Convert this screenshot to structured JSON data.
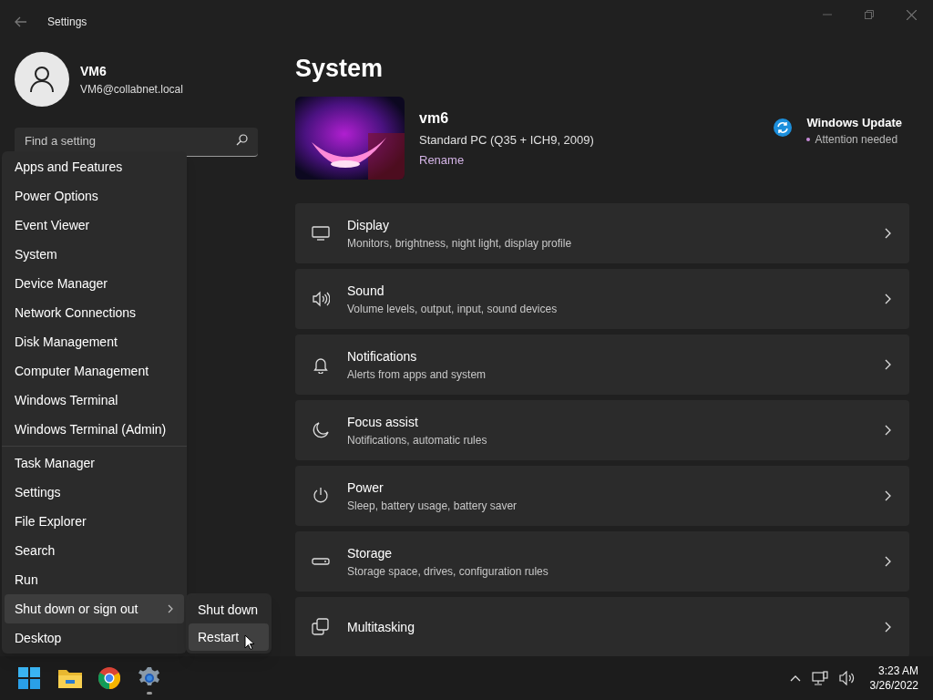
{
  "window": {
    "title": "Settings"
  },
  "account": {
    "name": "VM6",
    "email": "VM6@collabnet.local"
  },
  "search": {
    "placeholder": "Find a setting"
  },
  "page_title": "System",
  "device": {
    "name": "vm6",
    "model": "Standard PC (Q35 + ICH9, 2009)",
    "rename": "Rename"
  },
  "update": {
    "title": "Windows Update",
    "status": "Attention needed"
  },
  "cards": [
    {
      "title": "Display",
      "subtitle": "Monitors, brightness, night light, display profile"
    },
    {
      "title": "Sound",
      "subtitle": "Volume levels, output, input, sound devices"
    },
    {
      "title": "Notifications",
      "subtitle": "Alerts from apps and system"
    },
    {
      "title": "Focus assist",
      "subtitle": "Notifications, automatic rules"
    },
    {
      "title": "Power",
      "subtitle": "Sleep, battery usage, battery saver"
    },
    {
      "title": "Storage",
      "subtitle": "Storage space, drives, configuration rules"
    },
    {
      "title": "Multitasking"
    }
  ],
  "context_menu": {
    "groups": [
      [
        {
          "label": "Apps and Features",
          "selected": false,
          "submenu": false
        },
        {
          "label": "Power Options",
          "selected": false,
          "submenu": false
        },
        {
          "label": "Event Viewer",
          "selected": false,
          "submenu": false
        },
        {
          "label": "System",
          "selected": false,
          "submenu": false
        },
        {
          "label": "Device Manager",
          "selected": false,
          "submenu": false
        },
        {
          "label": "Network Connections",
          "selected": false,
          "submenu": false
        },
        {
          "label": "Disk Management",
          "selected": false,
          "submenu": false
        },
        {
          "label": "Computer Management",
          "selected": false,
          "submenu": false
        },
        {
          "label": "Windows Terminal",
          "selected": false,
          "submenu": false
        },
        {
          "label": "Windows Terminal (Admin)",
          "selected": false,
          "submenu": false
        }
      ],
      [
        {
          "label": "Task Manager",
          "selected": false,
          "submenu": false
        },
        {
          "label": "Settings",
          "selected": false,
          "submenu": false
        },
        {
          "label": "File Explorer",
          "selected": false,
          "submenu": false
        },
        {
          "label": "Search",
          "selected": false,
          "submenu": false
        },
        {
          "label": "Run",
          "selected": false,
          "submenu": false
        },
        {
          "label": "Shut down or sign out",
          "selected": true,
          "submenu": true
        },
        {
          "label": "Desktop",
          "selected": false,
          "submenu": false
        }
      ]
    ]
  },
  "submenu": [
    {
      "label": "Shut down",
      "selected": false
    },
    {
      "label": "Restart",
      "selected": true
    }
  ],
  "taskbar": {
    "time": "3:23 AM",
    "date": "3/26/2022"
  }
}
